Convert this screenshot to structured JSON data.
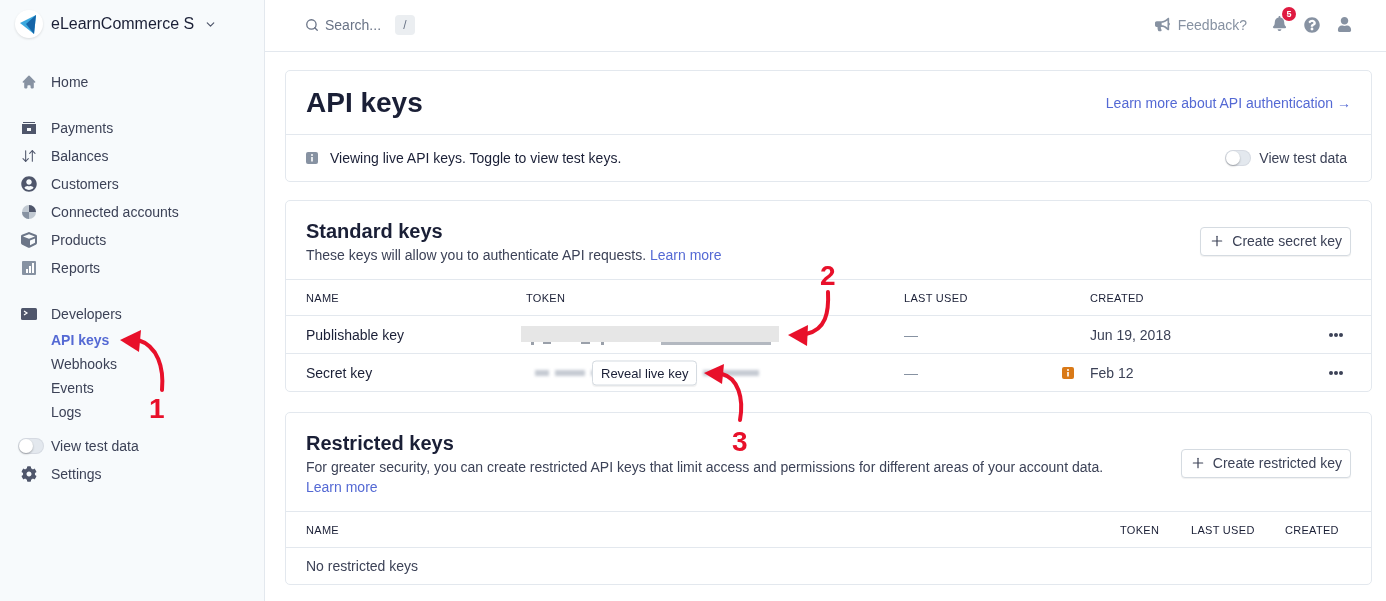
{
  "sidebar": {
    "account": "eLearnCommerce S",
    "sections": [
      {
        "items": [
          {
            "kind": "link",
            "label": "Home",
            "selected": false
          }
        ]
      },
      {
        "items": [
          {
            "kind": "link",
            "label": "Payments",
            "selected": false
          },
          {
            "kind": "link",
            "label": "Balances",
            "selected": false
          },
          {
            "kind": "link",
            "label": "Customers",
            "selected": false
          },
          {
            "kind": "link",
            "label": "Connected accounts",
            "selected": false
          },
          {
            "kind": "link",
            "label": "Products",
            "selected": false
          },
          {
            "kind": "link",
            "label": "Reports",
            "selected": false
          }
        ]
      },
      {
        "items": [
          {
            "kind": "link",
            "label": "Developers",
            "selected": false,
            "children": [
              {
                "label": "API keys",
                "selected": true
              },
              {
                "label": "Webhooks",
                "selected": false
              },
              {
                "label": "Events",
                "selected": false
              },
              {
                "label": "Logs",
                "selected": false
              }
            ]
          },
          {
            "kind": "toggle",
            "label": "View test data",
            "on": false
          },
          {
            "kind": "link",
            "label": "Settings",
            "selected": false
          }
        ]
      }
    ]
  },
  "top_bar": {
    "search": {
      "placeholder": "Search...",
      "shortcut": "/"
    },
    "feedback": "Feedback?",
    "notification_count": "5"
  },
  "api_keys": {
    "title": "API keys",
    "link": "Learn more about API authentication →",
    "notice": "Viewing live API keys. Toggle to view test keys.",
    "test_toggle": {
      "label": "View test data",
      "on": false
    }
  },
  "standard_keys": {
    "title": "Standard keys",
    "description": "These keys will allow you to authenticate API requests.",
    "link": "Learn more",
    "button": "Create secret key",
    "columns": [
      "NAME",
      "TOKEN",
      "LAST USED",
      "CREATED"
    ],
    "rows": [
      {
        "name": "Publishable key",
        "token": {
          "kind": "redacted"
        },
        "last_used": "—",
        "warning": false,
        "created": "Jun 19, 2018"
      },
      {
        "name": "Secret key",
        "token": {
          "kind": "hidden",
          "button": "Reveal live key"
        },
        "last_used": "—",
        "warning": true,
        "created": "Feb 12"
      }
    ]
  },
  "restricted_keys": {
    "title": "Restricted keys",
    "description": "For greater security, you can create restricted API keys that limit access and permissions for different areas of your account data.",
    "link": "Learn more",
    "button": "Create restricted key",
    "columns": [
      "NAME",
      "TOKEN",
      "LAST USED",
      "CREATED"
    ],
    "empty_message": "No restricted keys"
  },
  "annotations": [
    {
      "number": "1"
    },
    {
      "number": "2"
    },
    {
      "number": "3"
    }
  ]
}
